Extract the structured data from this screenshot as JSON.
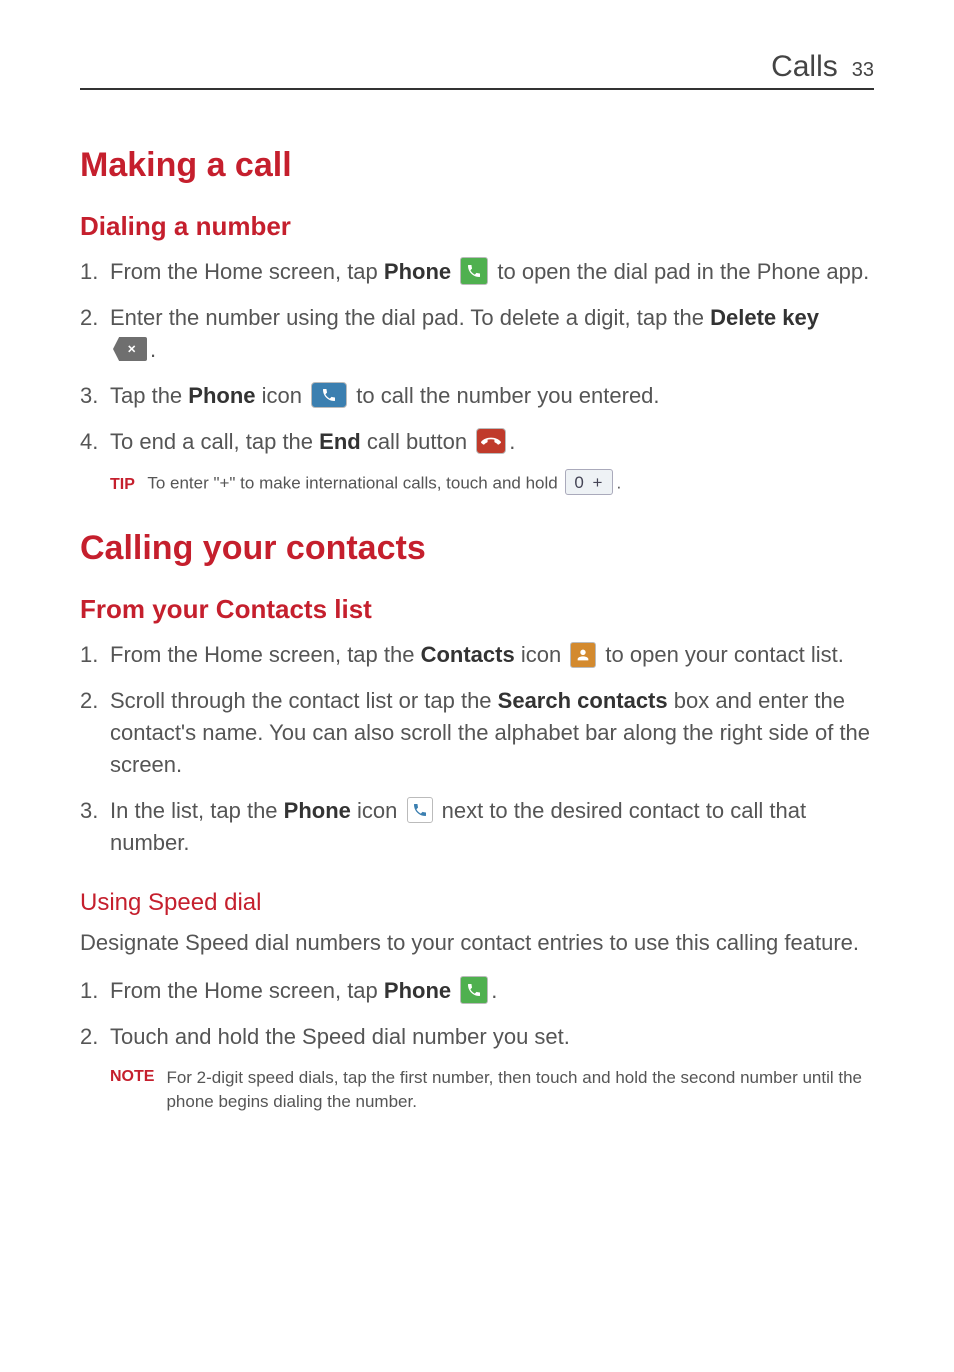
{
  "header": {
    "title": "Calls",
    "page_number": "33"
  },
  "section1": {
    "title": "Making a call",
    "sub1": {
      "title": "Dialing a number",
      "step1_a": "From the Home screen, tap ",
      "step1_phone": "Phone",
      "step1_b": " to open the dial pad in the Phone app.",
      "step2_a": "Enter the number using the dial pad. To delete a digit, tap the ",
      "step2_delete": "Delete key",
      "step2_b": ".",
      "step3_a": "Tap the ",
      "step3_phone": "Phone",
      "step3_b": " icon ",
      "step3_c": " to call the number you entered.",
      "step4_a": "To end a call, tap the ",
      "step4_end": "End",
      "step4_b": " call button ",
      "step4_c": ".",
      "tip_label": "TIP",
      "tip_a": "To enter \"+\" to make international calls, touch and hold ",
      "tip_zero": "0  +",
      "tip_b": "."
    }
  },
  "section2": {
    "title": "Calling your contacts",
    "sub1": {
      "title": "From your Contacts list",
      "step1_a": "From the Home screen, tap the ",
      "step1_contacts": "Contacts",
      "step1_b": " icon ",
      "step1_c": " to open your contact list.",
      "step2_a": "Scroll through the contact list or tap the ",
      "step2_search": "Search contacts",
      "step2_b": " box and enter the contact's name. You can also scroll the alphabet bar along the right side of the screen.",
      "step3_a": "In the list, tap the ",
      "step3_phone": "Phone",
      "step3_b": " icon ",
      "step3_c": " next to the desired contact to call that number."
    },
    "sub2": {
      "title": "Using Speed dial",
      "intro": "Designate Speed dial numbers to your contact entries to use this calling feature.",
      "step1_a": "From the Home screen, tap ",
      "step1_phone": "Phone",
      "step1_b": ".",
      "step2": "Touch and hold the Speed dial number you set.",
      "note_label": "NOTE",
      "note_text": "For 2-digit speed dials, tap the first number, then touch and hold the second number until the phone begins dialing the number."
    }
  }
}
